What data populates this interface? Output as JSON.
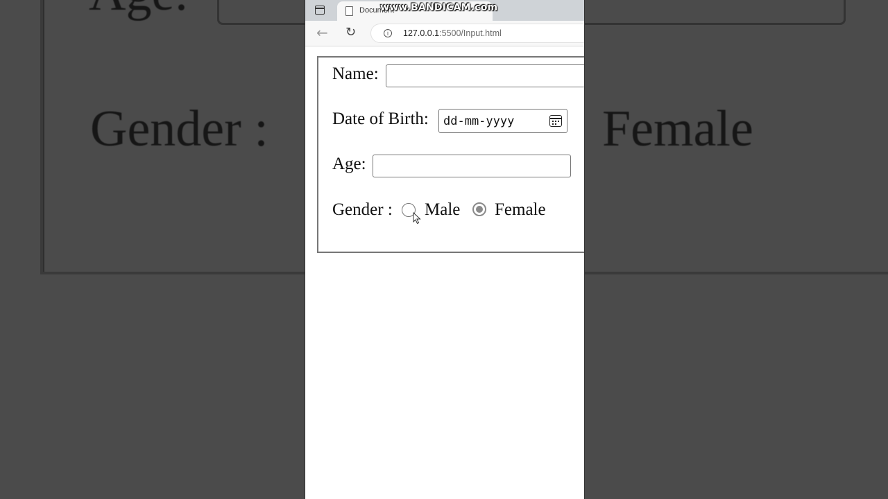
{
  "background": {
    "age_label": "Age:",
    "gender_label": "Gender :",
    "female_label": "Female"
  },
  "browser": {
    "tab_title": "Document",
    "watermark": "www.BANDICAM.com",
    "url_host": "127.0.0.1",
    "url_path": ":5500/Input.html",
    "icons": {
      "back": "arrow-left-icon",
      "reload": "reload-icon",
      "info": "info-icon",
      "tab_strip": "tab-strip-icon",
      "page": "page-icon"
    }
  },
  "form": {
    "name_label": "Name:",
    "name_value": "",
    "dob_label": "Date of Birth:",
    "dob_placeholder": "dd-mm-yyyy",
    "age_label": "Age:",
    "age_value": "",
    "gender_label": "Gender :",
    "gender_options": [
      {
        "label": "Male",
        "checked": false
      },
      {
        "label": "Female",
        "checked": true
      }
    ]
  }
}
